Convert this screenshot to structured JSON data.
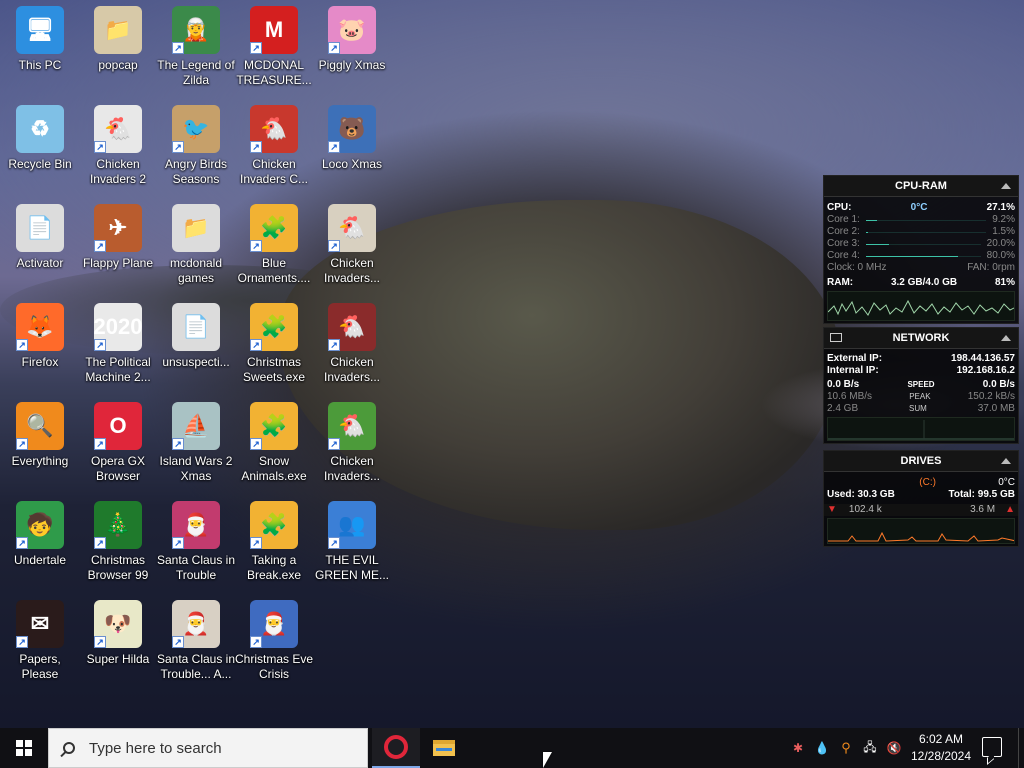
{
  "desktop": {
    "icons": [
      {
        "label": "This PC",
        "icon": "monitor-icon",
        "color": "#2d8fe0",
        "glyph": "🖥"
      },
      {
        "label": "popcap",
        "icon": "folder-icon",
        "color": "#d7c9a8",
        "glyph": "📁"
      },
      {
        "label": "The Legend of Zilda",
        "icon": "game-character-icon",
        "color": "#3b8a4a",
        "glyph": "🧝"
      },
      {
        "label": "MCDONAL TREASURE...",
        "icon": "mcdonalds-icon",
        "color": "#d41f1f",
        "glyph": "M"
      },
      {
        "label": "Piggly Xmas",
        "icon": "pig-icon",
        "color": "#e58ac8",
        "glyph": "🐷"
      },
      {
        "label": "Recycle Bin",
        "icon": "recycle-bin-icon",
        "color": "#7fc0e6",
        "glyph": "♻"
      },
      {
        "label": "Chicken Invaders 2",
        "icon": "chicken-icon",
        "color": "#e8e8e8",
        "glyph": "🐔"
      },
      {
        "label": "Angry Birds Seasons",
        "icon": "angry-bird-icon",
        "color": "#c6a06a",
        "glyph": "🐦"
      },
      {
        "label": "Chicken Invaders C...",
        "icon": "chicken-icon",
        "color": "#c8382d",
        "glyph": "🐔"
      },
      {
        "label": "Loco Xmas",
        "icon": "bear-icon",
        "color": "#3d70b8",
        "glyph": "🐻"
      },
      {
        "label": "Activator",
        "icon": "file-icon",
        "color": "#dcdcdc",
        "glyph": "📄"
      },
      {
        "label": "Flappy Plane",
        "icon": "plane-icon",
        "color": "#b95c2e",
        "glyph": "✈"
      },
      {
        "label": "mcdonald games",
        "icon": "folder-icon",
        "color": "#dcdcdc",
        "glyph": "📁"
      },
      {
        "label": "Blue Ornaments....",
        "icon": "puzzle-icon",
        "color": "#f2b233",
        "glyph": "🧩"
      },
      {
        "label": "Chicken Invaders...",
        "icon": "chicken-icon",
        "color": "#d8d0c0",
        "glyph": "🐔"
      },
      {
        "label": "Firefox",
        "icon": "firefox-icon",
        "color": "#ff6a2a",
        "glyph": "🦊"
      },
      {
        "label": "The Political Machine 2...",
        "icon": "political-icon",
        "color": "#e9e9e9",
        "glyph": "2020"
      },
      {
        "label": "unsuspecti...",
        "icon": "file-icon",
        "color": "#dcdcdc",
        "glyph": "📄"
      },
      {
        "label": "Christmas Sweets.exe",
        "icon": "puzzle-icon",
        "color": "#f2b233",
        "glyph": "🧩"
      },
      {
        "label": "Chicken Invaders...",
        "icon": "chicken-icon",
        "color": "#8a2b2b",
        "glyph": "🐔"
      },
      {
        "label": "Everything",
        "icon": "magnifier-icon",
        "color": "#f08a1c",
        "glyph": "🔍"
      },
      {
        "label": "Opera GX Browser",
        "icon": "opera-gx-icon",
        "color": "#e0263a",
        "glyph": "O"
      },
      {
        "label": "Island Wars 2 Xmas",
        "icon": "ship-icon",
        "color": "#a9c2c4",
        "glyph": "⛵"
      },
      {
        "label": "Snow Animals.exe",
        "icon": "puzzle-icon",
        "color": "#f2b233",
        "glyph": "🧩"
      },
      {
        "label": "Chicken Invaders...",
        "icon": "chicken-icon",
        "color": "#4c9b3a",
        "glyph": "🐔"
      },
      {
        "label": "Undertale",
        "icon": "undertale-icon",
        "color": "#2f9b4a",
        "glyph": "🧒"
      },
      {
        "label": "Christmas Browser 99",
        "icon": "christmas-tree-icon",
        "color": "#1f7a2c",
        "glyph": "🎄"
      },
      {
        "label": "Santa Claus in Trouble",
        "icon": "santa-icon",
        "color": "#c23b6e",
        "glyph": "🎅"
      },
      {
        "label": "Taking a Break.exe",
        "icon": "puzzle-icon",
        "color": "#f2b233",
        "glyph": "🧩"
      },
      {
        "label": "THE EVIL GREEN ME...",
        "icon": "messenger-people-icon",
        "color": "#3b7fd6",
        "glyph": "👥"
      },
      {
        "label": "Papers, Please",
        "icon": "papers-please-icon",
        "color": "#2a1b1b",
        "glyph": "✉"
      },
      {
        "label": "Super Hilda",
        "icon": "pixel-dog-icon",
        "color": "#e8e8c8",
        "glyph": "🐶"
      },
      {
        "label": "Santa Claus in Trouble... A...",
        "icon": "santa-icon",
        "color": "#d8d0c4",
        "glyph": "🎅"
      },
      {
        "label": "Christmas Eve Crisis",
        "icon": "santa-icon",
        "color": "#3f6bc0",
        "glyph": "🎅"
      }
    ]
  },
  "widget_cpu": {
    "title": "CPU-RAM",
    "cpu_label": "CPU:",
    "cpu_temp": "0°C",
    "cpu_pct": "27.1%",
    "cores": [
      {
        "label": "Core 1:",
        "value": "9.2%",
        "fill": 9.2
      },
      {
        "label": "Core 2:",
        "value": "1.5%",
        "fill": 1.5
      },
      {
        "label": "Core 3:",
        "value": "20.0%",
        "fill": 20.0
      },
      {
        "label": "Core 4:",
        "value": "80.0%",
        "fill": 80.0
      }
    ],
    "clock": "Clock: 0 MHz",
    "fan": "FAN: 0rpm",
    "ram_label": "RAM:",
    "ram_usage": "3.2 GB/4.0 GB",
    "ram_pct": "81%"
  },
  "widget_net": {
    "title": "NETWORK",
    "ext_label": "External IP:",
    "ext_ip": "198.44.136.57",
    "int_label": "Internal IP:",
    "int_ip": "192.168.16.2",
    "speed_down": "0.0 B/s",
    "speed_label": "SPEED",
    "speed_up": "0.0 B/s",
    "peak_down": "10.6 MB/s",
    "peak_label": "PEAK",
    "peak_up": "150.2 kB/s",
    "sum_down": "2.4 GB",
    "sum_label": "SUM",
    "sum_up": "37.0 MB"
  },
  "widget_drives": {
    "title": "DRIVES",
    "drive": "(C:)",
    "temp": "0°C",
    "used": "Used: 30.3 GB",
    "total": "Total: 99.5 GB",
    "read": "102.4 k",
    "write": "3.6 M"
  },
  "taskbar": {
    "search_placeholder": "Type here to search",
    "time": "6:02 AM",
    "date": "12/28/2024"
  },
  "colors": {
    "accent": "#3ec2a8",
    "opera": "#e0263a",
    "taskbar": "#101014"
  }
}
